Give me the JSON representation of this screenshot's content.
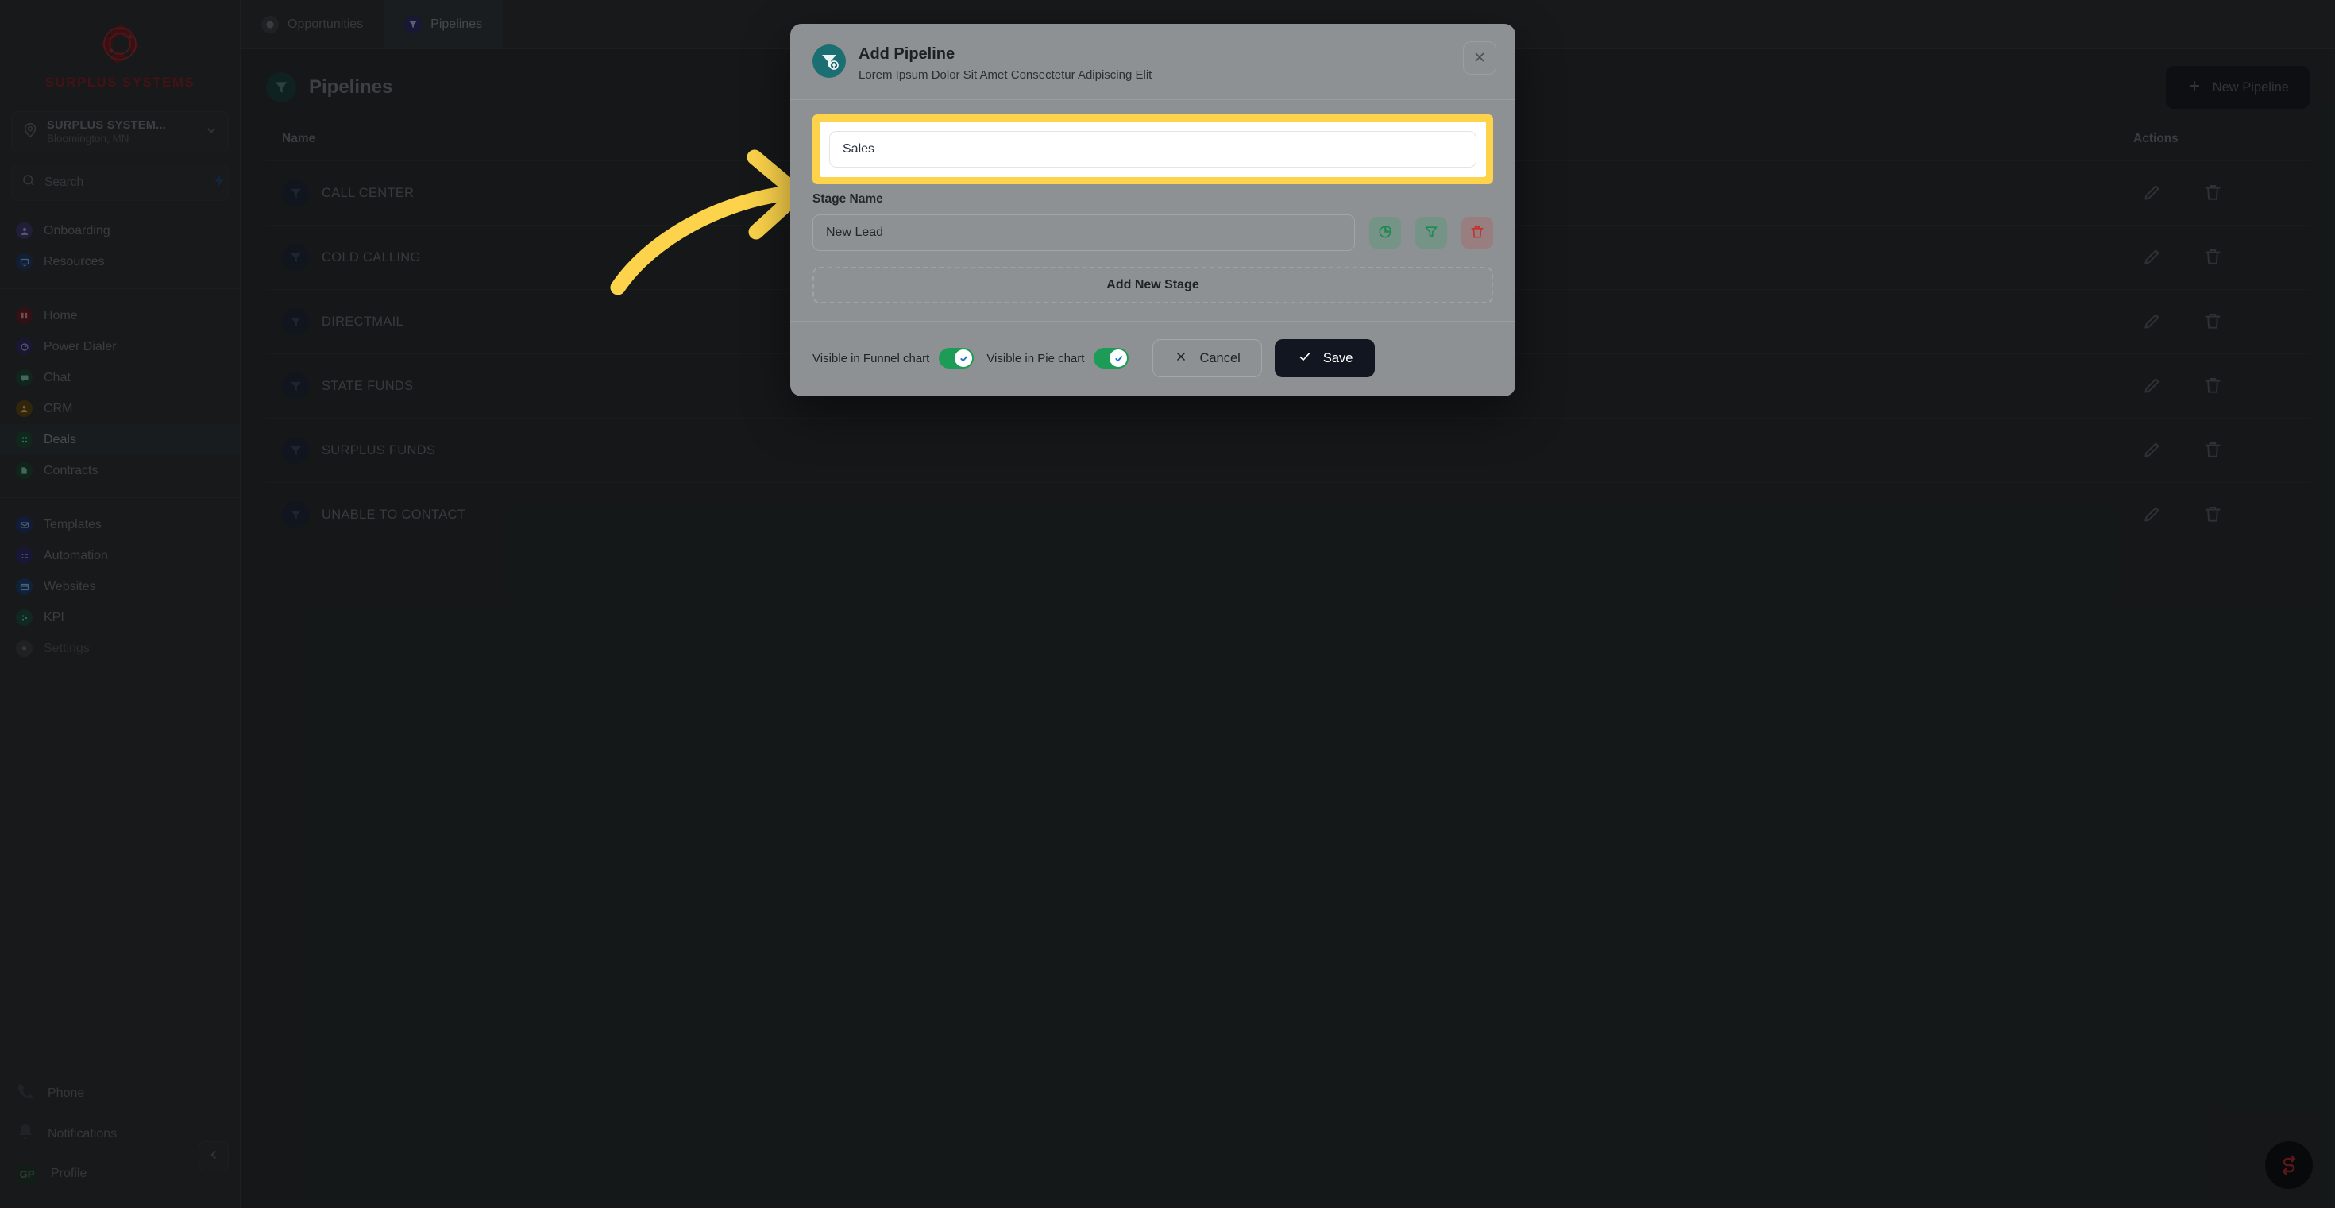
{
  "sidebar": {
    "brand": {
      "name": "SURPLUS SYSTEMS",
      "logo_icon": "surplus-systems-logo"
    },
    "location": {
      "icon": "map-pin-icon",
      "title": "SURPLUS SYSTEM...",
      "subtitle": "Bloomington, MN",
      "chevron_icon": "chevron-down-icon"
    },
    "search": {
      "icon": "search-icon",
      "placeholder": "Search",
      "value": "",
      "action_icon": "lightning-bolt-icon"
    },
    "groups": [
      {
        "items": [
          {
            "label": "Onboarding",
            "icon": "user-circle-icon",
            "color": "#3e3566",
            "active": false
          },
          {
            "label": "Resources",
            "icon": "monitor-icon",
            "color": "#1e3a63",
            "active": false
          }
        ]
      },
      {
        "items": [
          {
            "label": "Home",
            "icon": "home-icon",
            "color": "#5c1f26",
            "active": false
          },
          {
            "label": "Power Dialer",
            "icon": "phone-dial-icon",
            "color": "#2f2a5e",
            "active": false
          },
          {
            "label": "Chat",
            "icon": "chat-icon",
            "color": "#1c4438",
            "active": false
          },
          {
            "label": "CRM",
            "icon": "contact-icon",
            "color": "#5a4415",
            "active": false
          },
          {
            "label": "Deals",
            "icon": "deals-icon",
            "color": "#1c4a36",
            "active": true
          },
          {
            "label": "Contracts",
            "icon": "contract-icon",
            "color": "#1c4434",
            "active": false
          }
        ]
      },
      {
        "items": [
          {
            "label": "Templates",
            "icon": "mail-template-icon",
            "color": "#1f3566",
            "active": false
          },
          {
            "label": "Automation",
            "icon": "automation-icon",
            "color": "#2f2a66",
            "active": false
          },
          {
            "label": "Websites",
            "icon": "website-icon",
            "color": "#1c3f6e",
            "active": false
          },
          {
            "label": "KPI",
            "icon": "kpi-icon",
            "color": "#1c4a3c",
            "active": false
          },
          {
            "label": "Settings",
            "icon": "gear-icon",
            "color": "#3a3e41",
            "active": false
          }
        ]
      }
    ],
    "bottom": {
      "phone": {
        "label": "Phone",
        "icon": "phone-icon"
      },
      "notifications": {
        "label": "Notifications",
        "icon": "bell-icon"
      },
      "profile": {
        "label": "Profile",
        "avatar_initials": "GP"
      },
      "collapse_icon": "chevron-left-icon"
    }
  },
  "main": {
    "tabs": [
      {
        "label": "Opportunities",
        "icon": "opportunities-icon",
        "active": false
      },
      {
        "label": "Pipelines",
        "icon": "pipeline-icon",
        "active": true
      }
    ],
    "page_title": "Pipelines",
    "page_icon": "pipeline-icon",
    "new_button": {
      "label": "New Pipeline",
      "icon": "plus-icon"
    },
    "table": {
      "columns": [
        "Name",
        "Actions"
      ],
      "rows": [
        {
          "name": "CALL CENTER"
        },
        {
          "name": "COLD CALLING"
        },
        {
          "name": "DIRECTMAIL"
        },
        {
          "name": "STATE FUNDS"
        },
        {
          "name": "SURPLUS FUNDS"
        },
        {
          "name": "UNABLE TO CONTACT"
        }
      ],
      "row_actions": [
        {
          "icon": "edit-pencil-icon"
        },
        {
          "icon": "trash-icon"
        }
      ]
    },
    "fab_icon": "support-chat-logo-icon"
  },
  "modal": {
    "icon": "add-pipeline-icon",
    "title": "Add Pipeline",
    "subtitle": "Lorem Ipsum Dolor Sit Amet Consectetur Adipiscing Elit",
    "close_icon": "close-icon",
    "pipeline_name": {
      "value": "Sales",
      "placeholder": "Pipeline Name"
    },
    "stage_label": "Stage Name",
    "stages": [
      {
        "value": "New Lead",
        "placeholder": "Stage Name",
        "actions": [
          {
            "icon": "pie-chart-icon",
            "tone": "green"
          },
          {
            "icon": "funnel-icon",
            "tone": "green"
          },
          {
            "icon": "trash-icon",
            "tone": "red"
          }
        ]
      }
    ],
    "add_stage_label": "Add New Stage",
    "toggles": [
      {
        "label": "Visible in Funnel chart",
        "on": true
      },
      {
        "label": "Visible in Pie chart",
        "on": true
      }
    ],
    "cancel": {
      "label": "Cancel",
      "icon": "close-icon"
    },
    "save": {
      "label": "Save",
      "icon": "check-icon"
    }
  },
  "annotation": {
    "arrow_color": "#fcd34a",
    "highlight_color": "#fcd34a"
  }
}
